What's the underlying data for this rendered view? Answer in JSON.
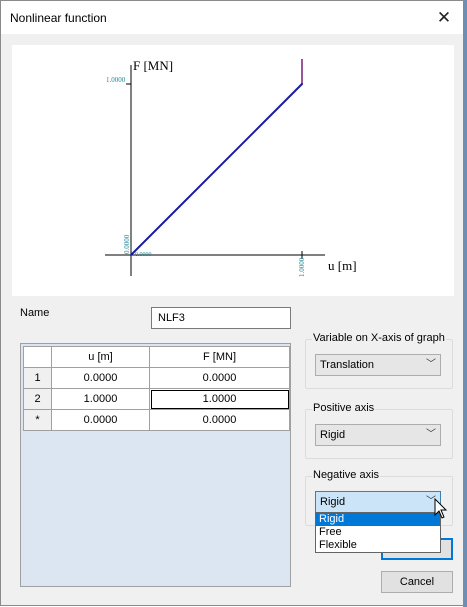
{
  "window": {
    "title": "Nonlinear function"
  },
  "graph": {
    "y_axis_label": "F [MN]",
    "x_axis_label": "u [m]",
    "y_tick_label": "1.0000",
    "x_tick_label": "1.0000",
    "origin_x_label": "0.0000",
    "origin_y_label": "0.0000",
    "line_color": "#1a1aa6",
    "vertical_color": "#7a1f7a",
    "tick_color": "#1f8a99"
  },
  "chart_data": {
    "type": "line",
    "xlabel": "u [m]",
    "ylabel": "F [MN]",
    "series": [
      {
        "x": [
          0.0,
          1.0
        ],
        "y": [
          0.0,
          1.0
        ]
      }
    ],
    "xlim": [
      0,
      1
    ],
    "ylim": [
      0,
      1
    ]
  },
  "name": {
    "label": "Name",
    "value": "NLF3"
  },
  "table": {
    "headers": [
      "u [m]",
      "F [MN]"
    ],
    "rows": [
      {
        "id": "1",
        "u": "0.0000",
        "f": "0.0000"
      },
      {
        "id": "2",
        "u": "1.0000",
        "f": "1.0000"
      },
      {
        "id": "*",
        "u": "0.0000",
        "f": "0.0000"
      }
    ]
  },
  "x_axis_variable": {
    "label": "Variable on X-axis of graph",
    "value": "Translation"
  },
  "positive_axis": {
    "label": "Positive axis",
    "value": "Rigid"
  },
  "negative_axis": {
    "label": "Negative axis",
    "value": "Rigid",
    "options": [
      "Rigid",
      "Free",
      "Flexible"
    ]
  },
  "buttons": {
    "cancel": "Cancel"
  }
}
